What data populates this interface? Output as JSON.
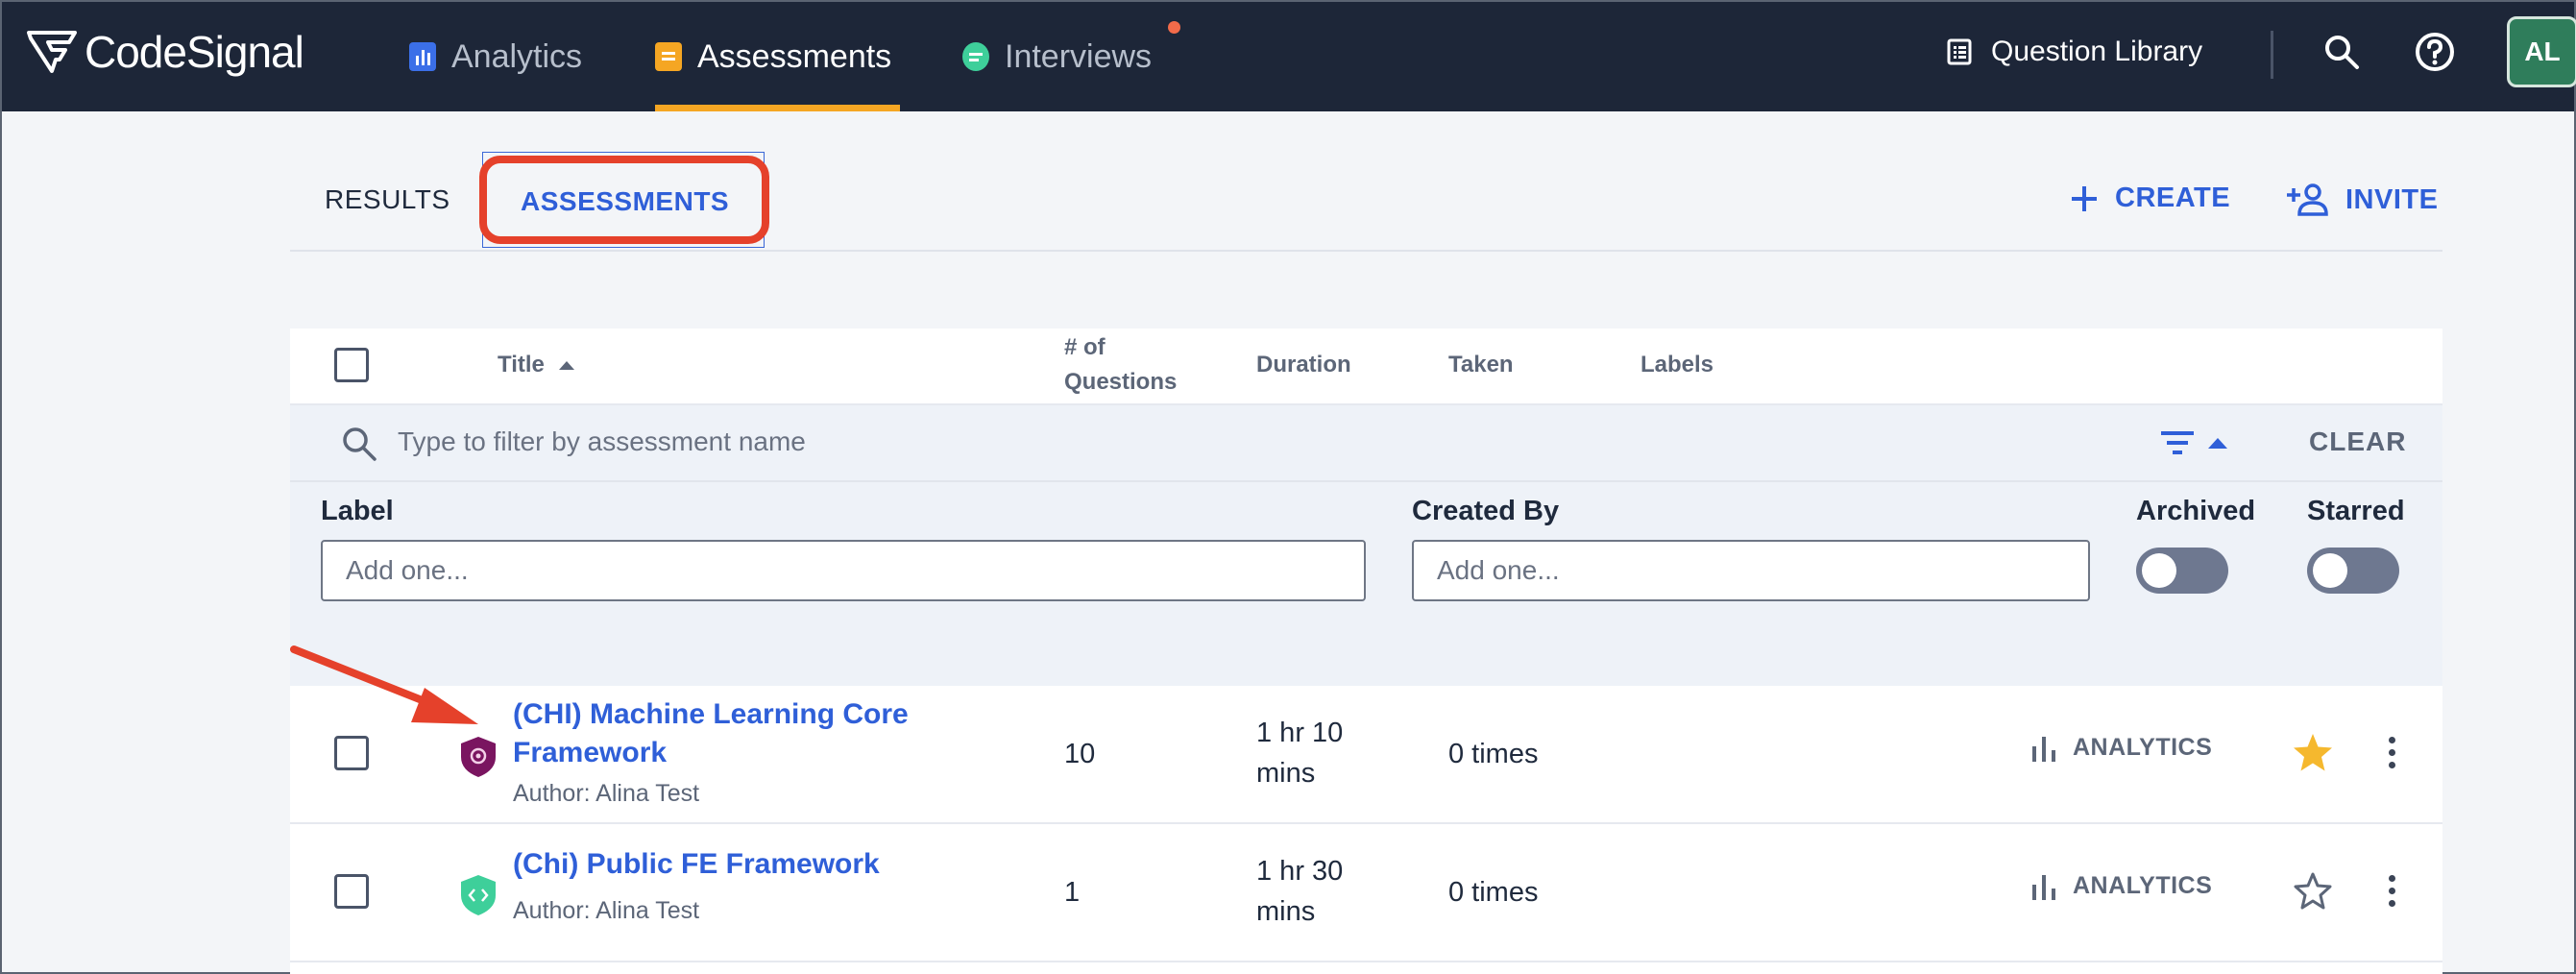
{
  "brand": {
    "name": "CodeSignal"
  },
  "nav": {
    "tabs": [
      {
        "label": "Analytics",
        "icon": "bar-chart-icon",
        "color": "#3b6fe8"
      },
      {
        "label": "Assessments",
        "icon": "assessment-icon",
        "color": "#f5a623",
        "active": true
      },
      {
        "label": "Interviews",
        "icon": "chat-icon",
        "color": "#3ecf9a",
        "has_notification": true
      }
    ],
    "question_library": "Question Library",
    "search_icon": "search-icon",
    "help_icon": "help-icon",
    "avatar_initials": "AL"
  },
  "subtabs": {
    "results": "RESULTS",
    "assessments": "ASSESSMENTS",
    "create": "CREATE",
    "invite": "INVITE"
  },
  "table": {
    "columns": {
      "title": "Title",
      "questions_line1": "# of",
      "questions_line2": "Questions",
      "duration": "Duration",
      "taken": "Taken",
      "labels": "Labels"
    },
    "filter": {
      "placeholder": "Type to filter by assessment name",
      "clear": "CLEAR"
    },
    "filters_panel": {
      "label_title": "Label",
      "label_placeholder": "Add one...",
      "created_by_title": "Created By",
      "created_by_placeholder": "Add one...",
      "archived_title": "Archived",
      "starred_title": "Starred",
      "archived_on": false,
      "starred_on": false
    },
    "rows": [
      {
        "title_line1": "(CHI) Machine Learning Core",
        "title_line2": "Framework",
        "author": "Author: Alina Test",
        "questions": "10",
        "duration_line1": "1 hr 10",
        "duration_line2": "mins",
        "taken": "0 times",
        "analytics": "ANALYTICS",
        "starred": true,
        "badge_color": "#7a1560"
      },
      {
        "title_line1": "(Chi) Public FE Framework",
        "author": "Author: Alina Test",
        "questions": "1",
        "duration_line1": "1 hr 30",
        "duration_line2": "mins",
        "taken": "0 times",
        "analytics": "ANALYTICS",
        "starred": false,
        "badge_color": "#3ecf9a"
      }
    ]
  },
  "colors": {
    "accent": "#2f5fd8",
    "nav_bg": "#1d2638",
    "highlight": "#e5412b",
    "star": "#f5b82e"
  }
}
